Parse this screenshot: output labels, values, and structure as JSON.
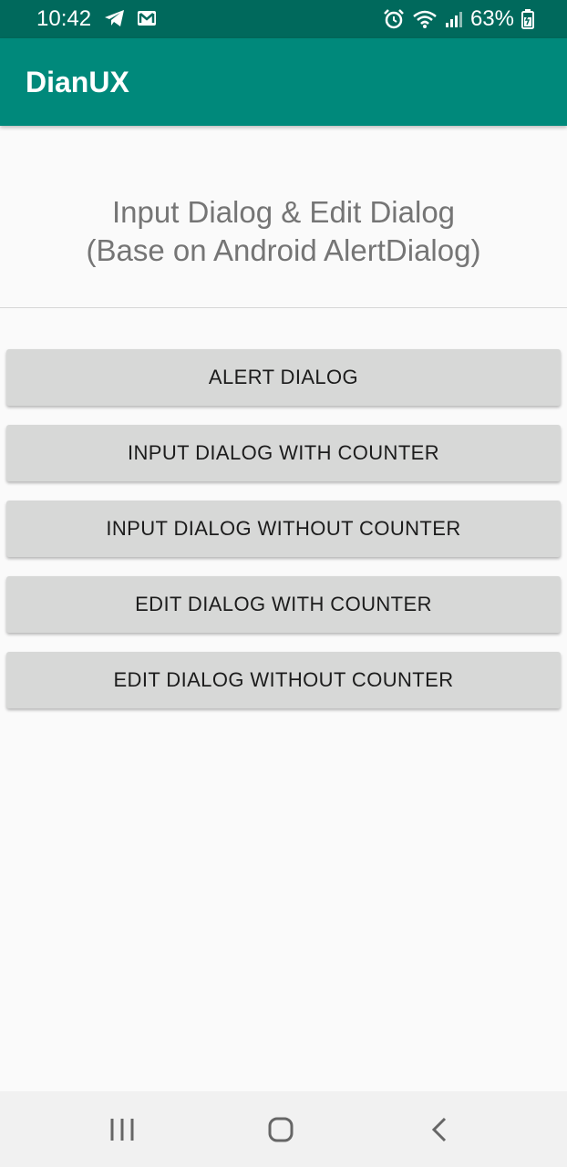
{
  "status_bar": {
    "time": "10:42",
    "battery": "63%",
    "icons": [
      "telegram-icon",
      "gmail-icon",
      "alarm-icon",
      "wifi-icon",
      "signal-icon",
      "battery-icon"
    ]
  },
  "app_bar": {
    "title": "DianUX"
  },
  "heading": {
    "line1": "Input Dialog & Edit Dialog",
    "line2": "(Base on Android AlertDialog)"
  },
  "buttons": [
    {
      "label": "ALERT DIALOG"
    },
    {
      "label": "INPUT DIALOG WITH COUNTER"
    },
    {
      "label": "INPUT DIALOG WITHOUT COUNTER"
    },
    {
      "label": "EDIT DIALOG WITH COUNTER"
    },
    {
      "label": "EDIT DIALOG WITHOUT COUNTER"
    }
  ],
  "nav_bar": {
    "icons": [
      "recent-apps-icon",
      "home-icon",
      "back-icon"
    ]
  },
  "colors": {
    "status_bar": "#00695c",
    "app_bar": "#00897b",
    "button": "#d7d8d7",
    "background": "#fafafa"
  }
}
